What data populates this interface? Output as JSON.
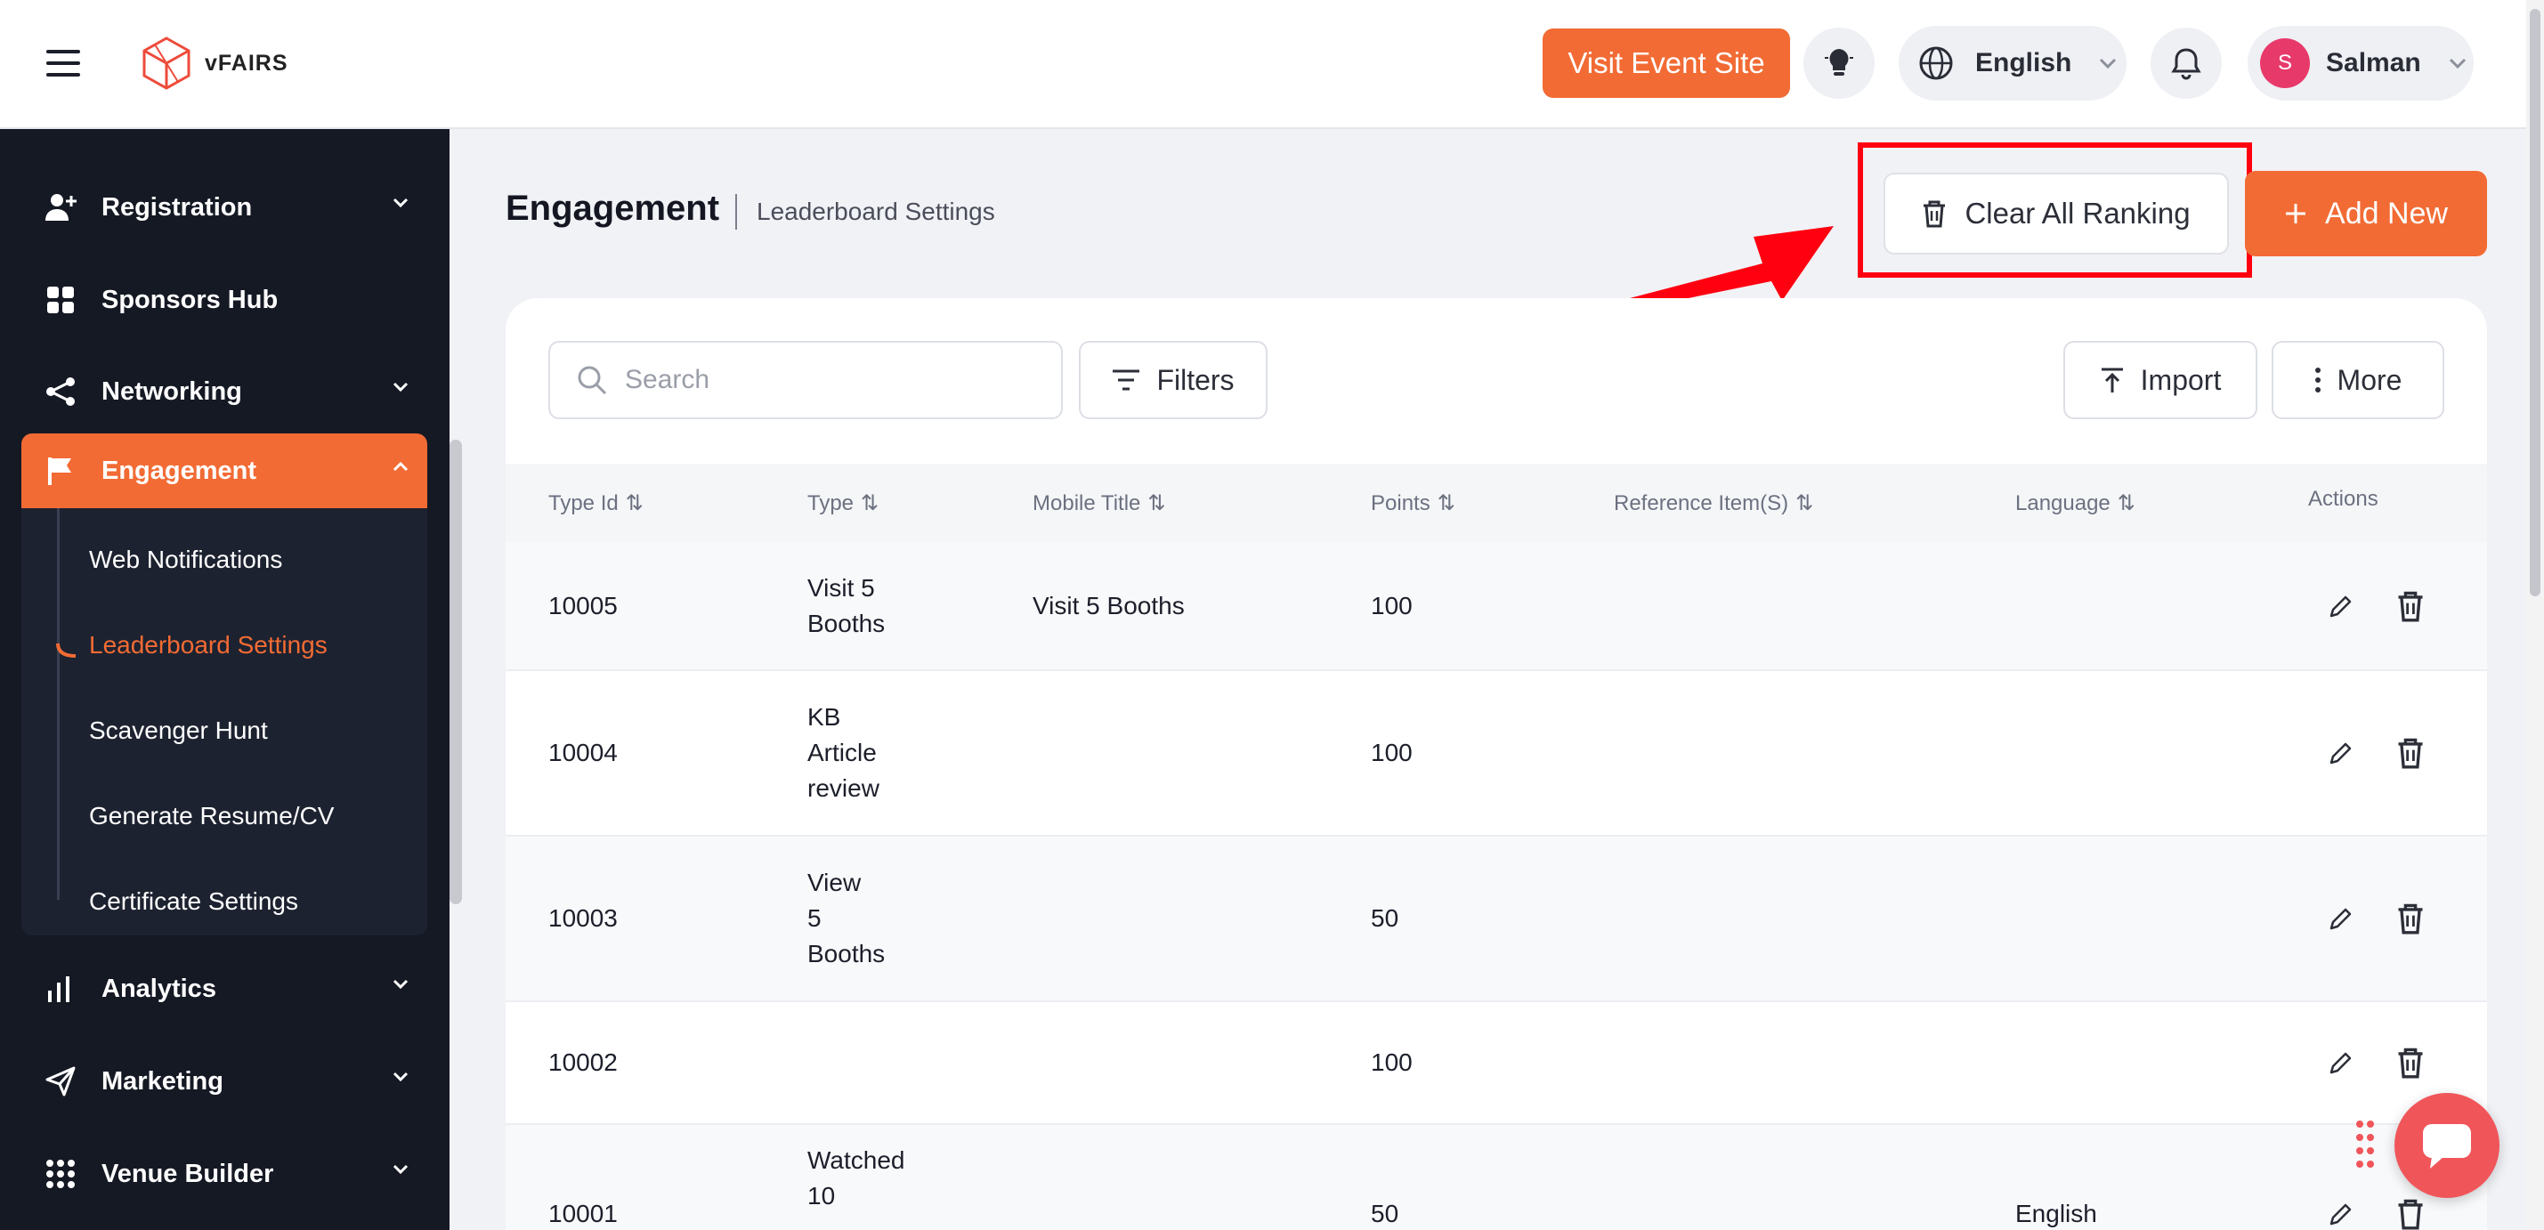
{
  "header": {
    "logo_text": "vFAIRS",
    "visit_label": "Visit Event Site",
    "language": "English",
    "user_name": "Salman",
    "user_initial": "S",
    "accent_color": "#f26b34"
  },
  "sidebar": {
    "items": [
      {
        "label": "Registration",
        "icon": "user-plus-icon"
      },
      {
        "label": "Sponsors Hub",
        "icon": "grid-icon"
      },
      {
        "label": "Networking",
        "icon": "share-icon"
      },
      {
        "label": "Engagement",
        "icon": "flag-icon"
      },
      {
        "label": "Analytics",
        "icon": "bar-chart-icon"
      },
      {
        "label": "Marketing",
        "icon": "send-icon"
      },
      {
        "label": "Venue Builder",
        "icon": "apps-icon"
      }
    ],
    "engagement_sub": [
      "Web Notifications",
      "Leaderboard Settings",
      "Scavenger Hunt",
      "Generate Resume/CV",
      "Certificate Settings"
    ]
  },
  "page": {
    "title": "Engagement",
    "subtitle": "Leaderboard Settings",
    "clear_label": "Clear All Ranking",
    "add_label": "Add New"
  },
  "toolbar": {
    "search_placeholder": "Search",
    "filters_label": "Filters",
    "import_label": "Import",
    "more_label": "More"
  },
  "table": {
    "columns": [
      "Type Id",
      "Type",
      "Mobile Title",
      "Points",
      "Reference Item(S)",
      "Language",
      "Actions"
    ],
    "rows": [
      {
        "id": "10005",
        "type": [
          "Visit 5",
          "Booths"
        ],
        "mobile": "Visit 5 Booths",
        "points": "100",
        "ref": "",
        "lang": ""
      },
      {
        "id": "10004",
        "type": [
          "KB",
          "Article",
          "review"
        ],
        "mobile": "",
        "points": "100",
        "ref": "",
        "lang": ""
      },
      {
        "id": "10003",
        "type": [
          "View",
          "5",
          "Booths"
        ],
        "mobile": "",
        "points": "50",
        "ref": "",
        "lang": ""
      },
      {
        "id": "10002",
        "type": [],
        "mobile": "",
        "points": "100",
        "ref": "",
        "lang": ""
      },
      {
        "id": "10001",
        "type": [
          "Watched",
          "10"
        ],
        "mobile": "",
        "points": "50",
        "ref": "",
        "lang": "English"
      }
    ]
  }
}
